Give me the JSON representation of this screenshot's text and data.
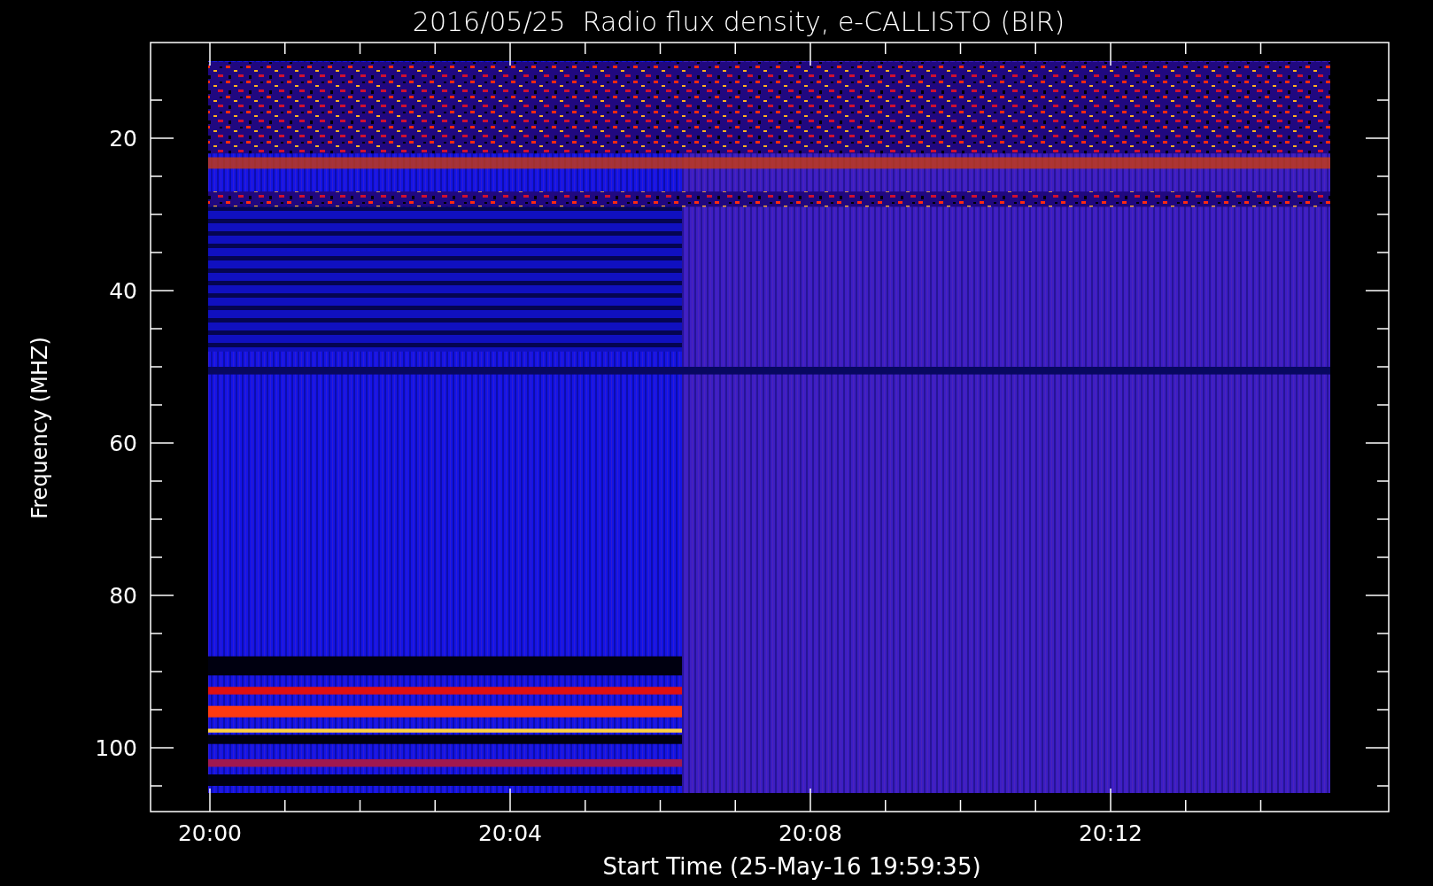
{
  "title": "2016/05/25  Radio flux density, e-CALLISTO (BIR)",
  "y_axis": {
    "label": "Frequency (MHZ)",
    "ticks": [
      "20",
      "40",
      "60",
      "80",
      "100"
    ]
  },
  "x_axis": {
    "label": "Start Time (25-May-16 19:59:35)",
    "ticks": [
      "20:00",
      "20:04",
      "20:08",
      "20:12"
    ]
  }
}
